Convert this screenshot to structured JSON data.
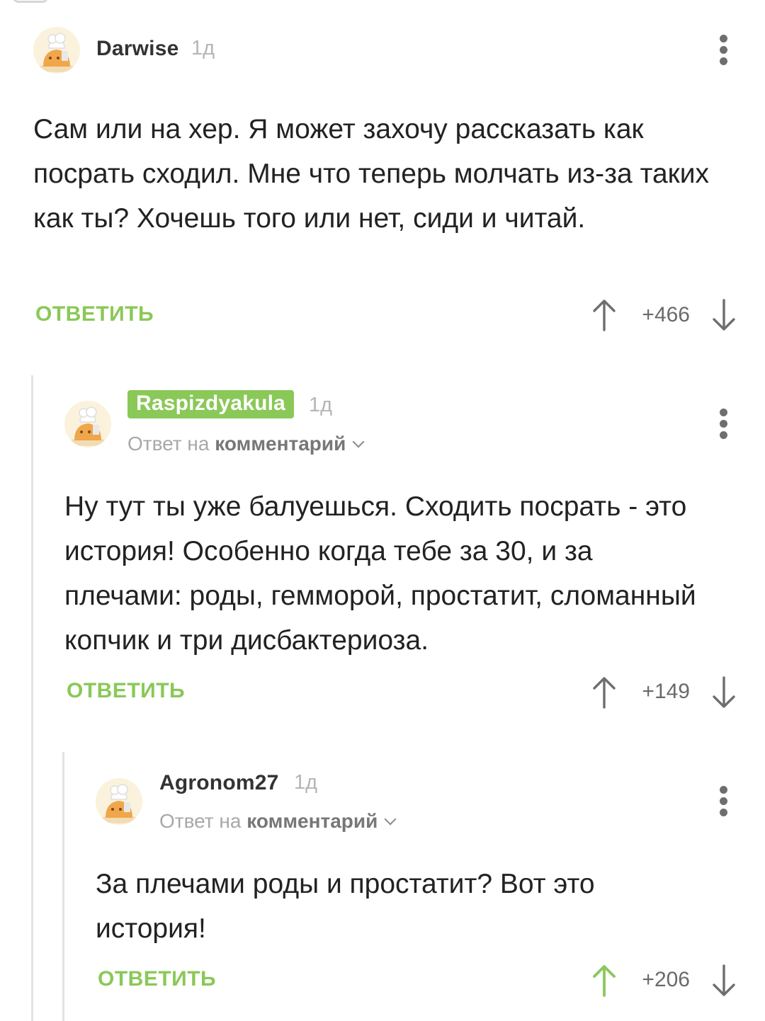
{
  "comments": [
    {
      "author": "Darwise",
      "age": "1д",
      "text": "Сам или на хер. Я может захочу рассказать как посрать сходил. Мне что теперь молчать из-за таких как ты? Хочешь того или нет, сиди и читай.",
      "reply_label": "ОТВЕТИТЬ",
      "score": "+466",
      "upvoted": false
    },
    {
      "author": "Raspizdyakula",
      "age": "1д",
      "reply_to_prefix": "Ответ на",
      "reply_to_link": "комментарий",
      "text": "Ну тут ты уже балуешься. Сходить посрать - это история! Особенно когда тебе за 30, и за плечами: роды, гемморой, простатит, сломанный копчик и три дисбактериоза.",
      "reply_label": "ОТВЕТИТЬ",
      "score": "+149",
      "upvoted": false
    },
    {
      "author": "Agronom27",
      "age": "1д",
      "reply_to_prefix": "Ответ на",
      "reply_to_link": "комментарий",
      "text": "За плечами роды и простатит? Вот это история!",
      "reply_label": "ОТВЕТИТЬ",
      "score": "+206",
      "upvoted": true
    }
  ],
  "colors": {
    "accent": "#8ac858",
    "vote_neutral": "#6e6e6e",
    "vote_active": "#8ac858"
  },
  "icons": {
    "avatar": "chef-cat-avatar-icon",
    "more": "more-vertical-icon",
    "upvote": "arrow-up-icon",
    "downvote": "arrow-down-icon",
    "expand": "chevron-down-icon"
  }
}
